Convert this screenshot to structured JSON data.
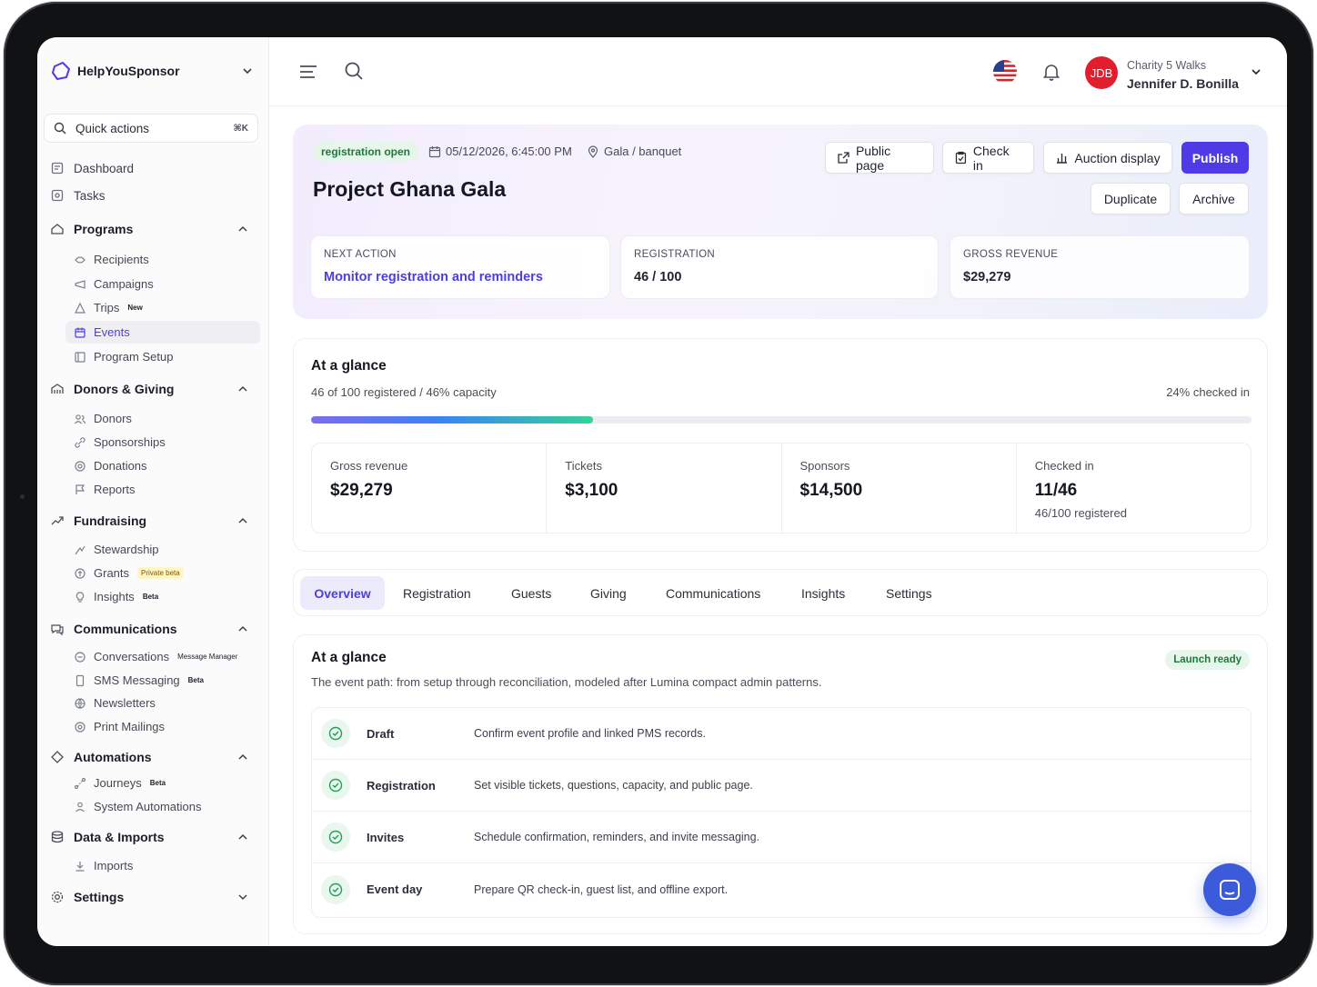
{
  "brand": {
    "name": "HelpYouSponsor"
  },
  "quick_actions": {
    "label": "Quick actions",
    "shortcut": "⌘K"
  },
  "nav": {
    "dashboard": "Dashboard",
    "tasks": "Tasks",
    "programs": {
      "label": "Programs",
      "items": [
        "Recipients",
        "Campaigns",
        "Trips",
        "Events",
        "Program Setup"
      ],
      "trips_tag": "New"
    },
    "donors": {
      "label": "Donors & Giving",
      "items": [
        "Donors",
        "Sponsorships",
        "Donations",
        "Reports"
      ]
    },
    "fundraising": {
      "label": "Fundraising",
      "items": [
        "Stewardship",
        "Grants",
        "Insights"
      ],
      "grants_tag": "Private beta",
      "insights_tag": "Beta"
    },
    "communications": {
      "label": "Communications",
      "items": [
        "Conversations",
        "SMS Messaging",
        "Newsletters",
        "Print Mailings"
      ],
      "conversations_tag": "Message Manager",
      "sms_tag": "Beta"
    },
    "automations": {
      "label": "Automations",
      "items": [
        "Journeys",
        "System Automations"
      ],
      "journeys_tag": "Beta"
    },
    "data": {
      "label": "Data & Imports",
      "items": [
        "Imports"
      ]
    },
    "settings": "Settings"
  },
  "user": {
    "org": "Charity 5 Walks",
    "name": "Jennifer D. Bonilla",
    "initials": "JDB"
  },
  "event": {
    "status": "registration open",
    "datetime": "05/12/2026, 6:45:00 PM",
    "location": "Gala / banquet",
    "title": "Project Ghana Gala"
  },
  "actions": {
    "public_page": "Public page",
    "check_in": "Check in",
    "auction_display": "Auction display",
    "publish": "Publish",
    "duplicate": "Duplicate",
    "archive": "Archive"
  },
  "kpis": [
    {
      "label": "NEXT ACTION",
      "value": "Monitor registration and reminders"
    },
    {
      "label": "REGISTRATION",
      "value": "46 / 100"
    },
    {
      "label": "GROSS REVENUE",
      "value": "$29,279"
    }
  ],
  "glance": {
    "title": "At a glance",
    "summary": "46 of 100 registered / 46% capacity",
    "checked_pct": "24% checked in",
    "progress": 0.3,
    "stats": [
      {
        "label": "Gross revenue",
        "value": "$29,279",
        "sub": ""
      },
      {
        "label": "Tickets",
        "value": "$3,100",
        "sub": ""
      },
      {
        "label": "Sponsors",
        "value": "$14,500",
        "sub": ""
      },
      {
        "label": "Checked in",
        "value": "11/46",
        "sub": "46/100 registered"
      }
    ]
  },
  "tabs": [
    "Overview",
    "Registration",
    "Guests",
    "Giving",
    "Communications",
    "Insights",
    "Settings"
  ],
  "path": {
    "title": "At a glance",
    "badge": "Launch ready",
    "description": "The event path: from setup through reconciliation, modeled after Lumina compact admin patterns.",
    "steps": [
      {
        "name": "Draft",
        "desc": "Confirm event profile and linked PMS records."
      },
      {
        "name": "Registration",
        "desc": "Set visible tickets, questions, capacity, and public page."
      },
      {
        "name": "Invites",
        "desc": "Schedule confirmation, reminders, and invite messaging."
      },
      {
        "name": "Event day",
        "desc": "Prepare QR check-in, guest list, and offline export."
      }
    ]
  },
  "colors": {
    "accent": "#4f3ae6",
    "success": "#1f7a3a",
    "avatar": "#e11d2e",
    "chat": "#3b5bdb"
  }
}
